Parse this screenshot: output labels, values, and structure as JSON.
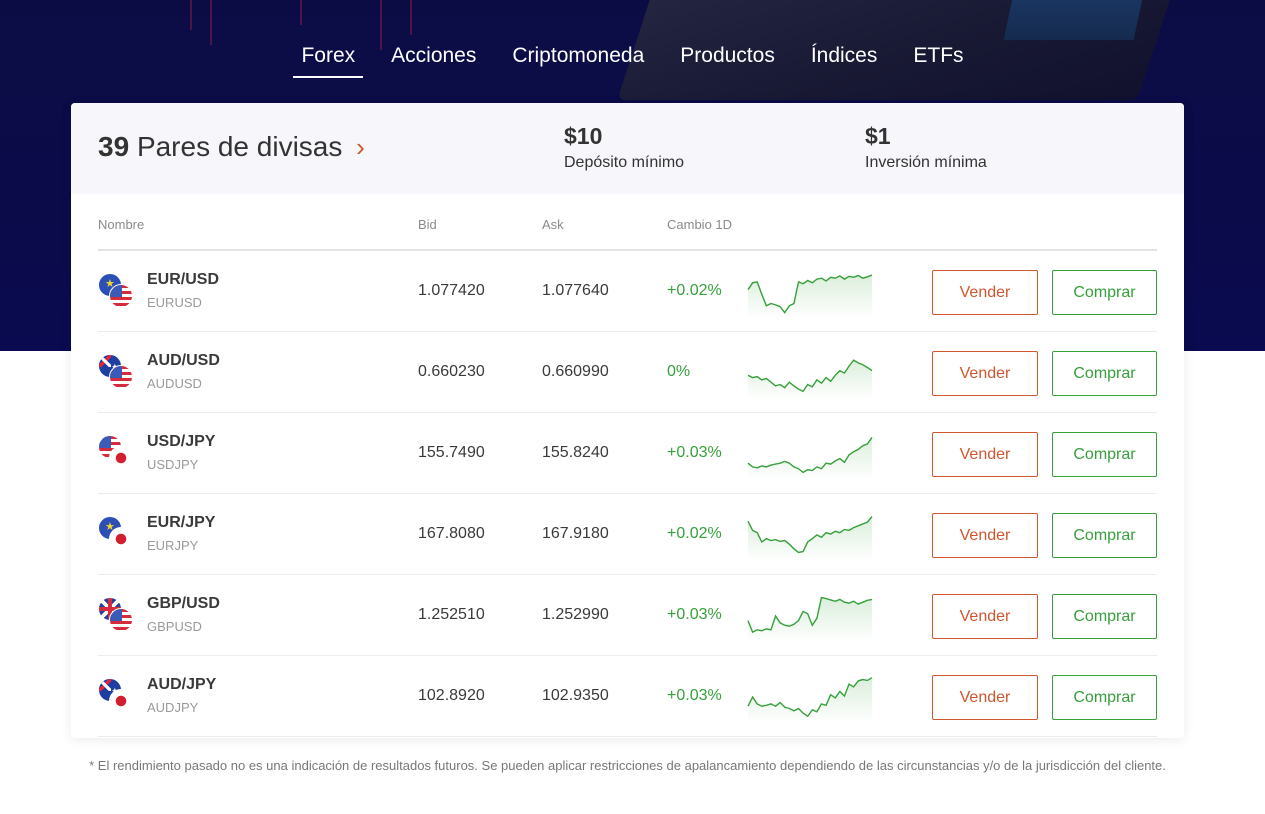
{
  "tabs": [
    {
      "label": "Forex",
      "active": true
    },
    {
      "label": "Acciones",
      "active": false
    },
    {
      "label": "Criptomoneda",
      "active": false
    },
    {
      "label": "Productos",
      "active": false
    },
    {
      "label": "Índices",
      "active": false
    },
    {
      "label": "ETFs",
      "active": false
    }
  ],
  "summary": {
    "pairs_count": "39",
    "pairs_label": "Pares de divisas",
    "min_deposit_value": "$10",
    "min_deposit_label": "Depósito mínimo",
    "min_investment_value": "$1",
    "min_investment_label": "Inversión mínima"
  },
  "table": {
    "headers": {
      "name": "Nombre",
      "bid": "Bid",
      "ask": "Ask",
      "change": "Cambio 1D"
    },
    "sell_label": "Vender",
    "buy_label": "Comprar",
    "rows": [
      {
        "symbol": "EUR/USD",
        "code": "EURUSD",
        "bid": "1.077420",
        "ask": "1.077640",
        "change": "+0.02%",
        "flags": [
          "eu",
          "us"
        ],
        "trend": [
          0.55,
          0.7,
          0.72,
          0.45,
          0.2,
          0.25,
          0.22,
          0.18,
          0.05,
          0.2,
          0.25,
          0.72,
          0.68,
          0.75,
          0.7,
          0.78,
          0.8,
          0.74,
          0.82,
          0.8,
          0.85,
          0.78,
          0.84,
          0.82,
          0.86,
          0.8,
          0.83,
          0.87
        ]
      },
      {
        "symbol": "AUD/USD",
        "code": "AUDUSD",
        "bid": "0.660230",
        "ask": "0.660990",
        "change": "0%",
        "flags": [
          "au",
          "us"
        ],
        "trend": [
          0.45,
          0.4,
          0.42,
          0.35,
          0.38,
          0.3,
          0.22,
          0.25,
          0.18,
          0.3,
          0.22,
          0.15,
          0.1,
          0.25,
          0.2,
          0.35,
          0.28,
          0.4,
          0.32,
          0.45,
          0.55,
          0.5,
          0.65,
          0.78,
          0.72,
          0.68,
          0.62,
          0.55
        ]
      },
      {
        "symbol": "USD/JPY",
        "code": "USDJPY",
        "bid": "155.7490",
        "ask": "155.8240",
        "change": "+0.03%",
        "flags": [
          "us",
          "jp"
        ],
        "trend": [
          0.3,
          0.22,
          0.2,
          0.24,
          0.22,
          0.26,
          0.28,
          0.3,
          0.34,
          0.3,
          0.22,
          0.18,
          0.1,
          0.16,
          0.14,
          0.22,
          0.18,
          0.3,
          0.28,
          0.35,
          0.4,
          0.32,
          0.48,
          0.55,
          0.6,
          0.68,
          0.72,
          0.86
        ]
      },
      {
        "symbol": "EUR/JPY",
        "code": "EURJPY",
        "bid": "167.8080",
        "ask": "167.9180",
        "change": "+0.02%",
        "flags": [
          "eu",
          "jp"
        ],
        "trend": [
          0.8,
          0.6,
          0.55,
          0.35,
          0.42,
          0.38,
          0.4,
          0.36,
          0.38,
          0.3,
          0.2,
          0.12,
          0.14,
          0.35,
          0.42,
          0.5,
          0.45,
          0.55,
          0.52,
          0.58,
          0.55,
          0.62,
          0.6,
          0.66,
          0.7,
          0.74,
          0.78,
          0.9
        ]
      },
      {
        "symbol": "GBP/USD",
        "code": "GBPUSD",
        "bid": "1.252510",
        "ask": "1.252990",
        "change": "+0.03%",
        "flags": [
          "gb",
          "us"
        ],
        "trend": [
          0.4,
          0.15,
          0.2,
          0.18,
          0.22,
          0.2,
          0.5,
          0.35,
          0.3,
          0.28,
          0.32,
          0.4,
          0.6,
          0.55,
          0.3,
          0.45,
          0.9,
          0.88,
          0.85,
          0.82,
          0.86,
          0.8,
          0.78,
          0.82,
          0.76,
          0.8,
          0.84,
          0.86
        ]
      },
      {
        "symbol": "AUD/JPY",
        "code": "AUDJPY",
        "bid": "102.8920",
        "ask": "102.9350",
        "change": "+0.03%",
        "flags": [
          "au",
          "jp"
        ],
        "trend": [
          0.3,
          0.5,
          0.35,
          0.3,
          0.32,
          0.35,
          0.3,
          0.38,
          0.28,
          0.25,
          0.2,
          0.25,
          0.15,
          0.08,
          0.22,
          0.18,
          0.35,
          0.32,
          0.55,
          0.48,
          0.62,
          0.52,
          0.78,
          0.72,
          0.85,
          0.88,
          0.86,
          0.92
        ]
      }
    ]
  },
  "disclaimer": "* El rendimiento pasado no es una indicación de resultados futuros. Se pueden aplicar restricciones de apalancamiento dependiendo de las circunstancias y/o de la jurisdicción del cliente.",
  "colors": {
    "hero": "#0c0c45",
    "sell": "#d0562e",
    "buy": "#36a03b",
    "chart": "#36a03b"
  }
}
